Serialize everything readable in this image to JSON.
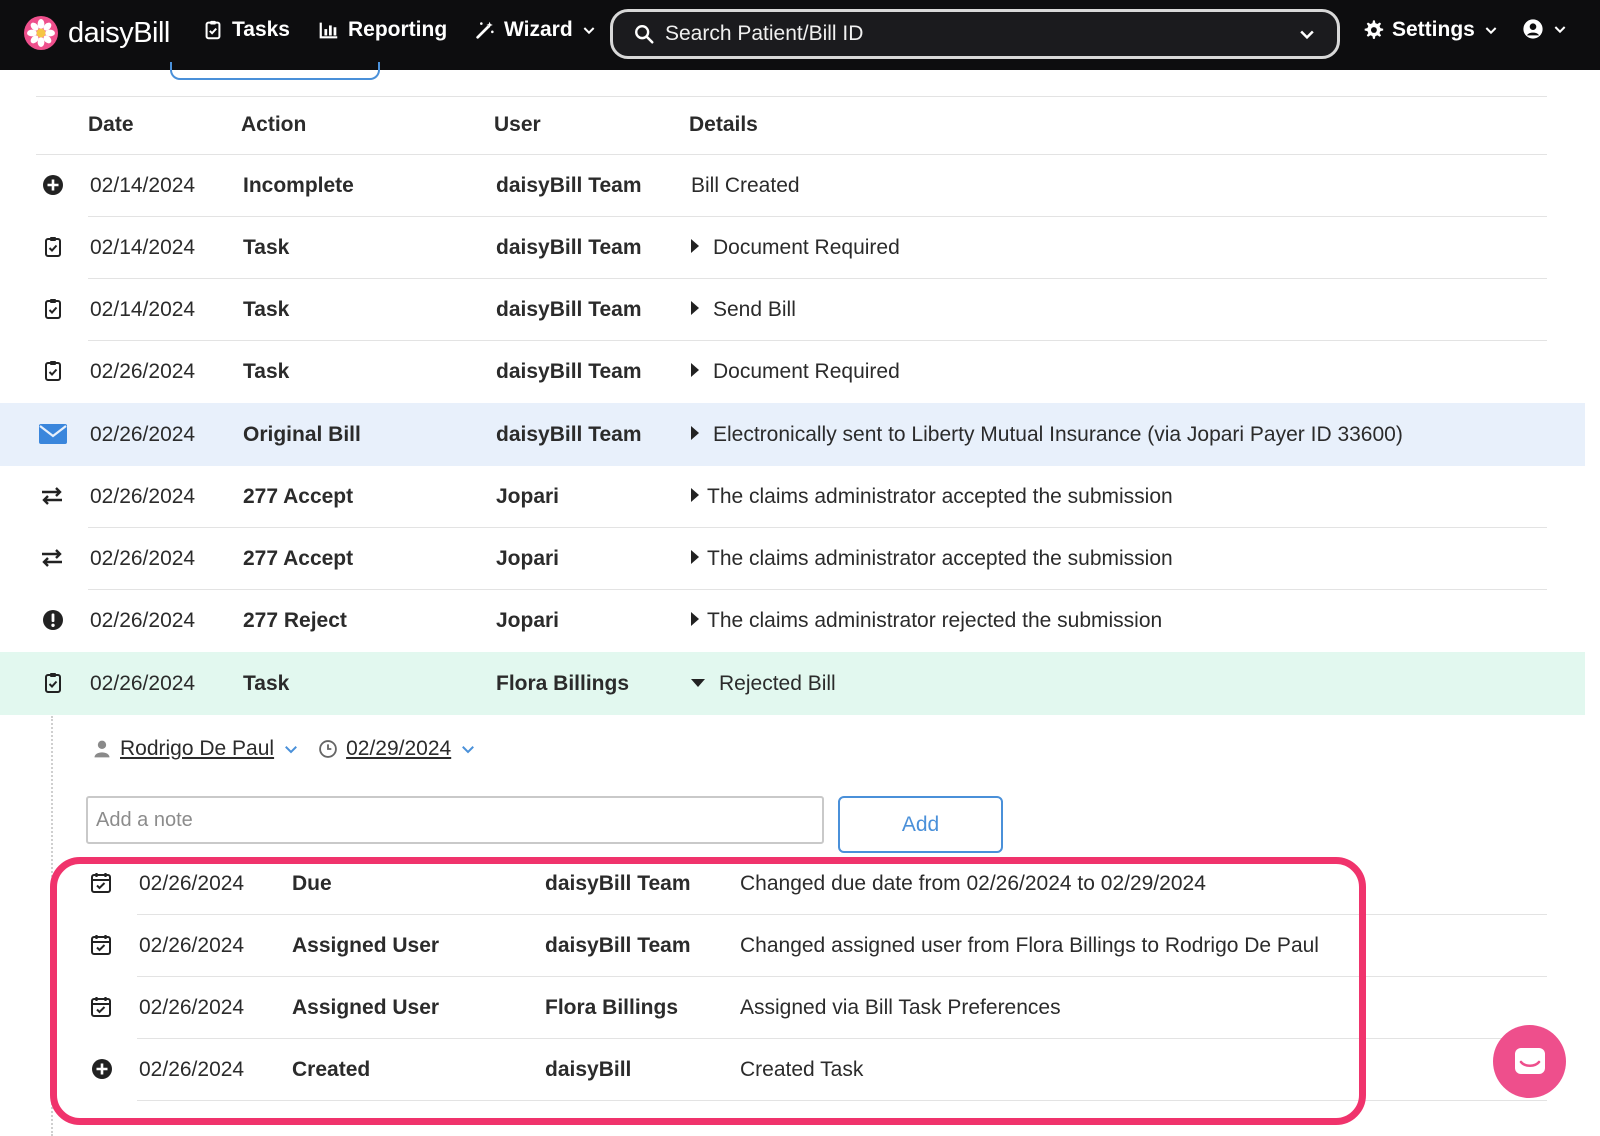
{
  "app": {
    "logo_text": "daisyBill"
  },
  "nav": {
    "tasks": "Tasks",
    "reporting": "Reporting",
    "wizard": "Wizard",
    "settings": "Settings"
  },
  "search": {
    "placeholder": "Search Patient/Bill ID"
  },
  "table": {
    "headers": {
      "date": "Date",
      "action": "Action",
      "user": "User",
      "details": "Details"
    },
    "rows": [
      {
        "icon": "plus-circle-icon",
        "date": "02/14/2024",
        "action": "Incomplete",
        "user": "daisyBill Team",
        "details": "Bill Created",
        "expandable": false
      },
      {
        "icon": "clipboard-check-icon",
        "date": "02/14/2024",
        "action": "Task",
        "user": "daisyBill Team",
        "details": "Document Required",
        "expandable": true
      },
      {
        "icon": "clipboard-check-icon",
        "date": "02/14/2024",
        "action": "Task",
        "user": "daisyBill Team",
        "details": "Send Bill",
        "expandable": true
      },
      {
        "icon": "clipboard-check-icon",
        "date": "02/26/2024",
        "action": "Task",
        "user": "daisyBill Team",
        "details": "Document Required",
        "expandable": true
      },
      {
        "icon": "envelope-icon",
        "date": "02/26/2024",
        "action": "Original Bill",
        "user": "daisyBill Team",
        "details": "Electronically sent to Liberty Mutual Insurance (via Jopari Payer ID 33600)",
        "expandable": true
      },
      {
        "icon": "transfer-arrows-icon",
        "date": "02/26/2024",
        "action": "277 Accept",
        "user": "Jopari",
        "details": "The claims administrator accepted the submission",
        "expandable": true
      },
      {
        "icon": "transfer-arrows-icon",
        "date": "02/26/2024",
        "action": "277 Accept",
        "user": "Jopari",
        "details": "The claims administrator accepted the submission",
        "expandable": true
      },
      {
        "icon": "exclamation-circle-icon",
        "date": "02/26/2024",
        "action": "277 Reject",
        "user": "Jopari",
        "details": "The claims administrator rejected the submission",
        "expandable": true
      },
      {
        "icon": "clipboard-check-icon",
        "date": "02/26/2024",
        "action": "Task",
        "user": "Flora Billings",
        "details": "Rejected Bill",
        "expandable": true,
        "expanded": true
      }
    ]
  },
  "task_detail": {
    "assignee": "Rodrigo De Paul",
    "due_date": "02/29/2024",
    "note_placeholder": "Add a note",
    "add_label": "Add",
    "history": [
      {
        "icon": "calendar-check-icon",
        "date": "02/26/2024",
        "action": "Due",
        "user": "daisyBill Team",
        "details": "Changed due date from 02/26/2024 to 02/29/2024"
      },
      {
        "icon": "calendar-check-icon",
        "date": "02/26/2024",
        "action": "Assigned User",
        "user": "daisyBill Team",
        "details": "Changed assigned user from Flora Billings to Rodrigo De Paul"
      },
      {
        "icon": "calendar-check-icon",
        "date": "02/26/2024",
        "action": "Assigned User",
        "user": "Flora Billings",
        "details": "Assigned via Bill Task Preferences"
      },
      {
        "icon": "plus-circle-icon",
        "date": "02/26/2024",
        "action": "Created",
        "user": "daisyBill",
        "details": "Created Task"
      }
    ]
  },
  "colors": {
    "topbar": "#0d0d0f",
    "accent_blue": "#4a90d9",
    "highlight_blue": "#e8f0fb",
    "highlight_green": "#e2f8ef",
    "annotation_pink": "#f0336c",
    "chat_pink": "#ee4f8c"
  }
}
